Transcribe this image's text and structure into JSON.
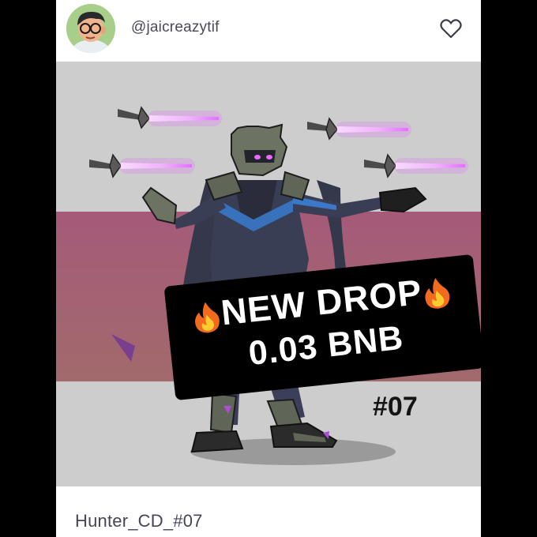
{
  "post": {
    "username": "@jaicreazytif",
    "title": "Hunter_CD_#07"
  },
  "artwork": {
    "banner_line1": "NEW DROP",
    "banner_line2": "0.03 BNB",
    "number_badge": "#07"
  },
  "icons": {
    "like": "heart-outline-icon",
    "banner_emoji": "fire-icon"
  },
  "colors": {
    "page_bg": "#000000",
    "art_bg": "#cdcdcd",
    "stripe": "#a35f74",
    "glow": "#e96bff"
  }
}
